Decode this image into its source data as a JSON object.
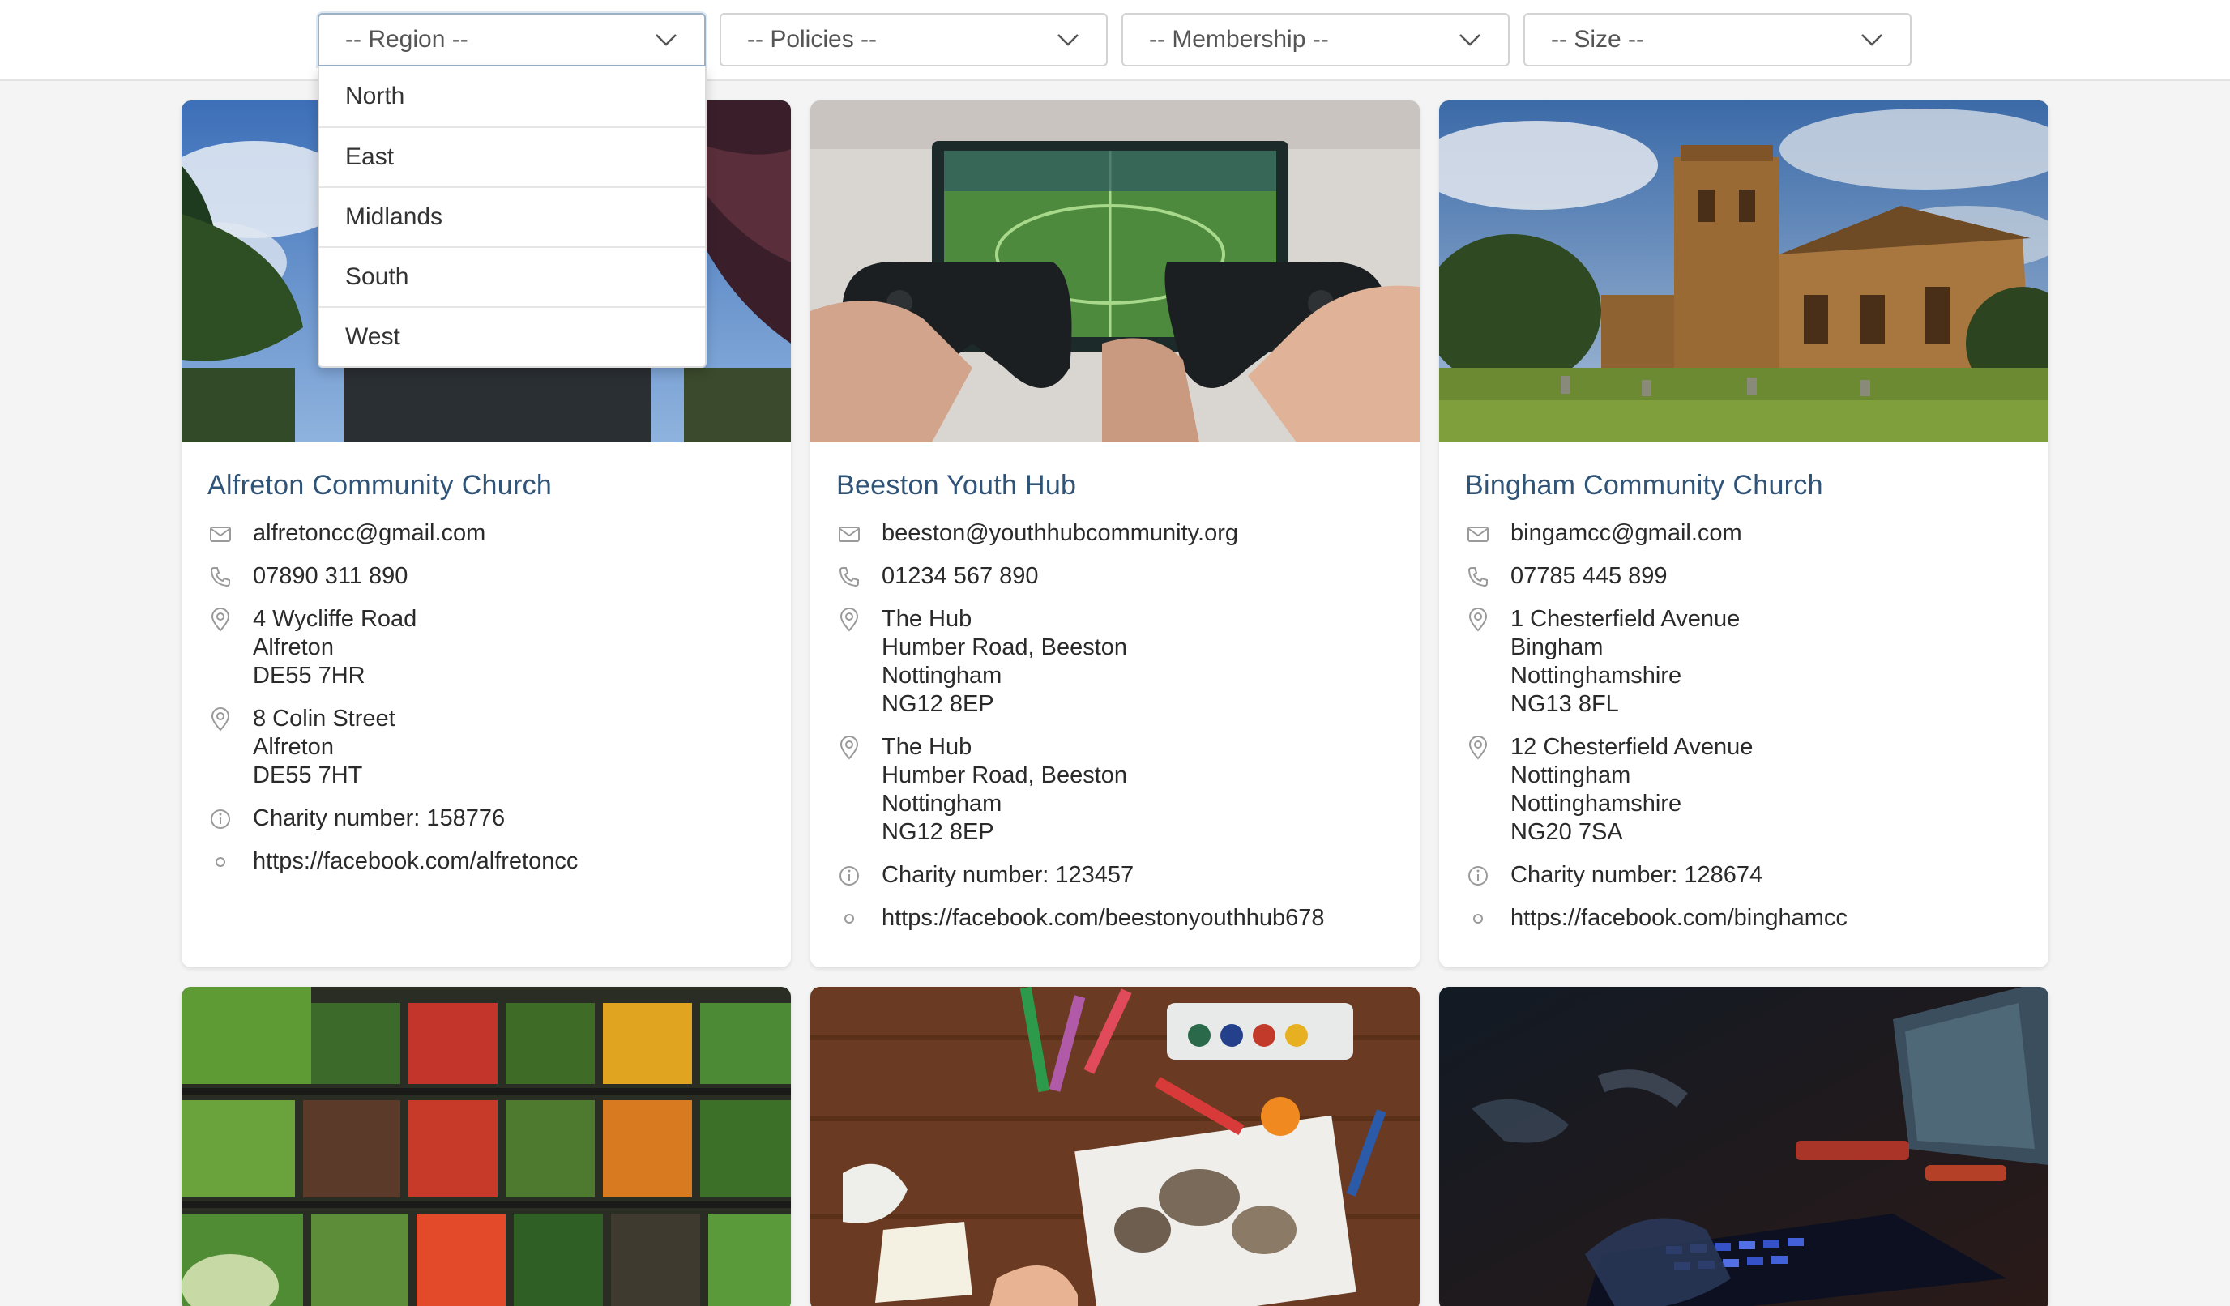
{
  "filters": [
    {
      "label": "-- Region --"
    },
    {
      "label": "-- Policies --"
    },
    {
      "label": "-- Membership --"
    },
    {
      "label": "-- Size --"
    }
  ],
  "region_options": [
    "North",
    "East",
    "Midlands",
    "South",
    "West"
  ],
  "cards": [
    {
      "title": "Alfreton Community Church",
      "email": "alfretoncc@gmail.com",
      "phone": "07890 311 890",
      "addresses": [
        [
          "4 Wycliffe Road",
          "Alfreton",
          "DE55 7HR"
        ],
        [
          "8 Colin Street",
          "Alfreton",
          "DE55 7HT"
        ]
      ],
      "charity": "Charity number: 158776",
      "link": "https://facebook.com/alfretoncc"
    },
    {
      "title": "Beeston Youth Hub",
      "email": "beeston@youthhubcommunity.org",
      "phone": "01234 567 890",
      "addresses": [
        [
          "The Hub",
          "Humber Road, Beeston",
          "Nottingham",
          "NG12 8EP"
        ],
        [
          "The Hub",
          "Humber Road, Beeston",
          "Nottingham",
          "NG12 8EP"
        ]
      ],
      "charity": "Charity number: 123457",
      "link": "https://facebook.com/beestonyouthhub678"
    },
    {
      "title": "Bingham Community Church",
      "email": "bingamcc@gmail.com",
      "phone": "07785 445 899",
      "addresses": [
        [
          "1 Chesterfield Avenue",
          "Bingham",
          "Nottinghamshire",
          "NG13 8FL"
        ],
        [
          "12 Chesterfield Avenue",
          "Nottingham",
          "Nottinghamshire",
          "NG20 7SA"
        ]
      ],
      "charity": "Charity number: 128674",
      "link": "https://facebook.com/binghamcc"
    }
  ],
  "colors": {
    "accent": "#2f5478",
    "icon": "#9a9a9a"
  }
}
